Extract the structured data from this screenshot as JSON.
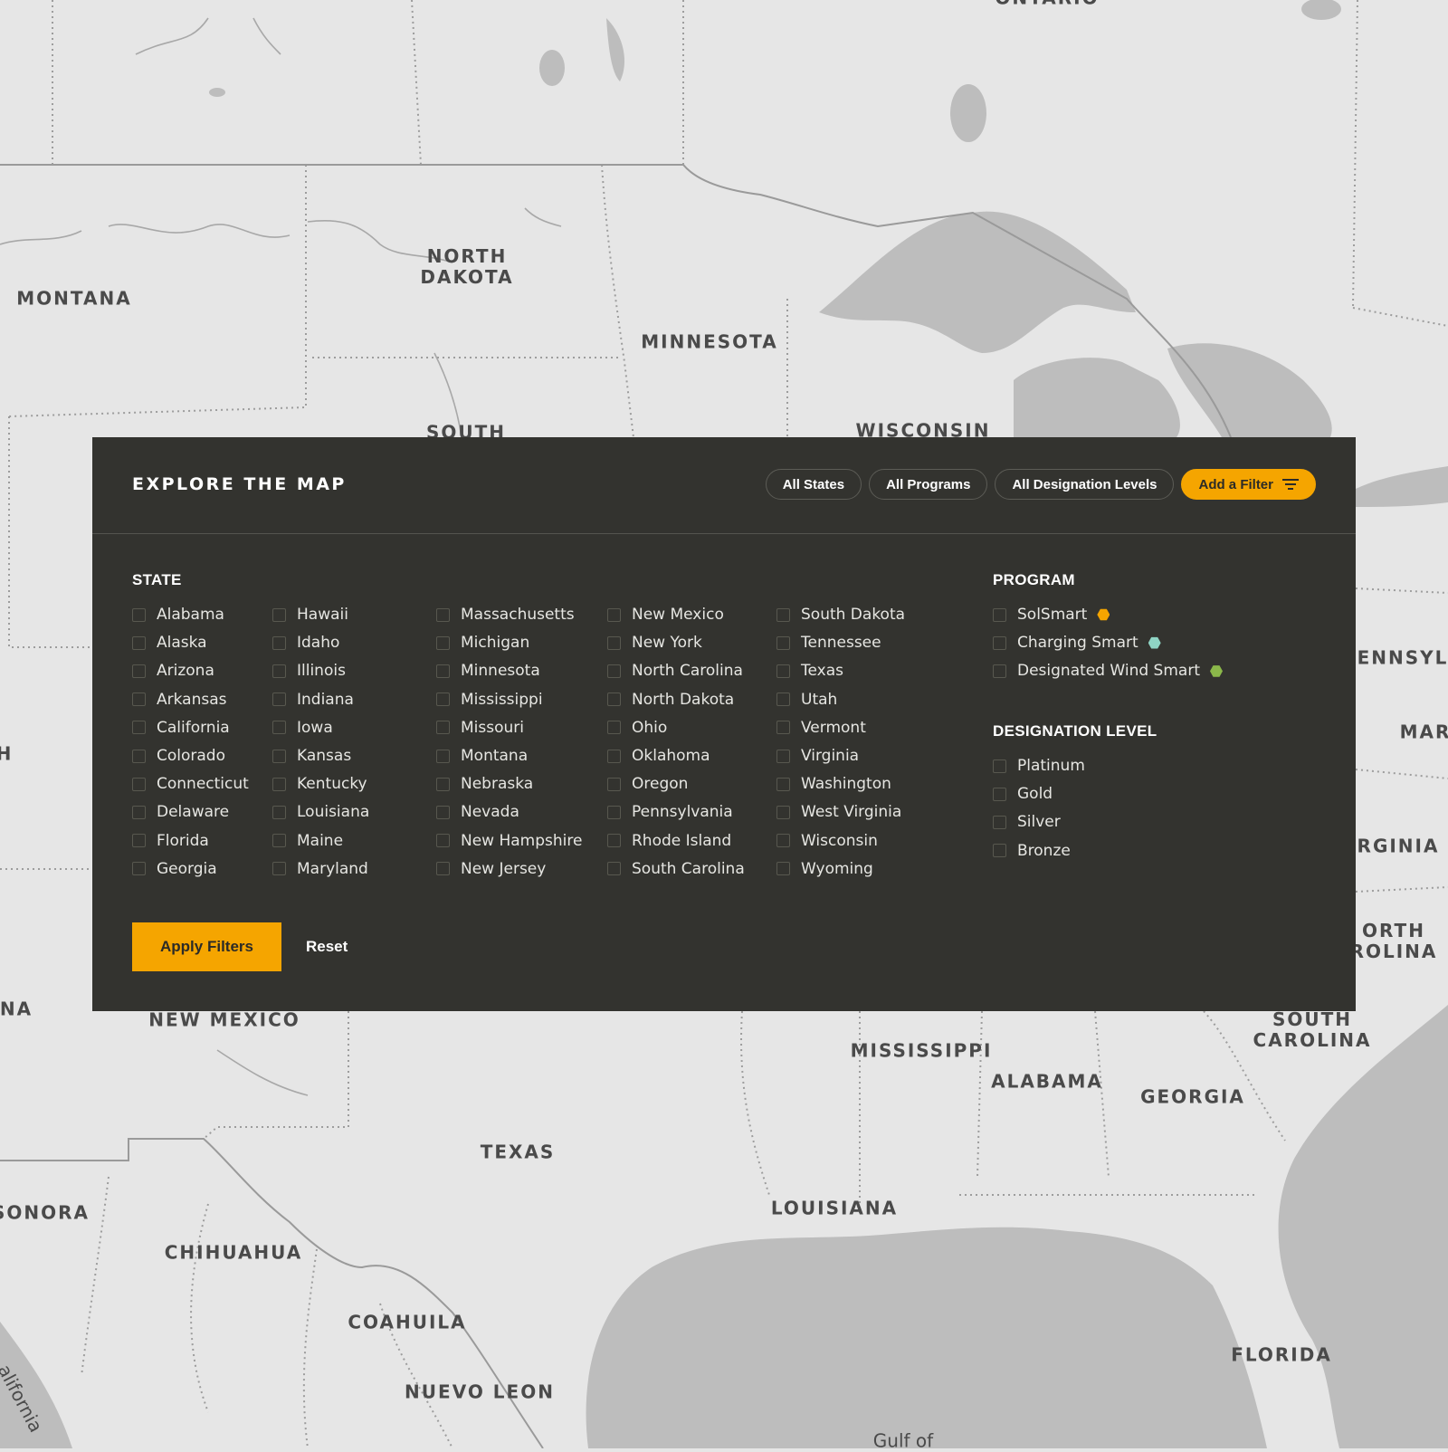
{
  "panel": {
    "title": "EXPLORE THE MAP",
    "pills": [
      {
        "label": "All States"
      },
      {
        "label": "All Programs"
      },
      {
        "label": "All Designation Levels"
      }
    ],
    "add_filter_label": "Add a Filter",
    "state_heading": "STATE",
    "states": [
      "Alabama",
      "Alaska",
      "Arizona",
      "Arkansas",
      "California",
      "Colorado",
      "Connecticut",
      "Delaware",
      "Florida",
      "Georgia",
      "Hawaii",
      "Idaho",
      "Illinois",
      "Indiana",
      "Iowa",
      "Kansas",
      "Kentucky",
      "Louisiana",
      "Maine",
      "Maryland",
      "Massachusetts",
      "Michigan",
      "Minnesota",
      "Mississippi",
      "Missouri",
      "Montana",
      "Nebraska",
      "Nevada",
      "New Hampshire",
      "New Jersey",
      "New Mexico",
      "New York",
      "North Carolina",
      "North Dakota",
      "Ohio",
      "Oklahoma",
      "Oregon",
      "Pennsylvania",
      "Rhode Island",
      "South Carolina",
      "South Dakota",
      "Tennessee",
      "Texas",
      "Utah",
      "Vermont",
      "Virginia",
      "Washington",
      "West Virginia",
      "Wisconsin",
      "Wyoming"
    ],
    "program_heading": "PROGRAM",
    "programs": [
      {
        "label": "SolSmart",
        "color": "#f5a500"
      },
      {
        "label": "Charging Smart",
        "color": "#8fd4c4"
      },
      {
        "label": "Designated Wind Smart",
        "color": "#8bb84a"
      }
    ],
    "designation_heading": "DESIGNATION LEVEL",
    "designation_levels": [
      "Platinum",
      "Gold",
      "Silver",
      "Bronze"
    ],
    "apply_label": "Apply Filters",
    "reset_label": "Reset"
  },
  "map": {
    "labels": {
      "ontario": "ONTARIO",
      "montana": "MONTANA",
      "north_dakota": "NORTH\nDAKOTA",
      "minnesota": "MINNESOTA",
      "south_dakota": "SOUTH",
      "wisconsin": "WISCONSIN",
      "pennsylvania": "ENNSYL",
      "maryland": "MAR",
      "virginia": "RGINIA",
      "north_carolina": "ORTH\nROLINA",
      "edge_h": "H",
      "edge_na": "NA",
      "new_mexico": "NEW MEXICO",
      "mississippi": "MISSISSIPPI",
      "alabama": "ALABAMA",
      "georgia": "GEORGIA",
      "south_carolina": "SOUTH\nCAROLINA",
      "texas": "TEXAS",
      "louisiana": "LOUISIANA",
      "sonora": "SONORA",
      "chihuahua": "CHIHUAHUA",
      "coahuila": "COAHUILA",
      "nuevo_leon": "NUEVO LEON",
      "florida": "FLORIDA",
      "gulf": "Gulf of",
      "california": "alifornia"
    }
  }
}
